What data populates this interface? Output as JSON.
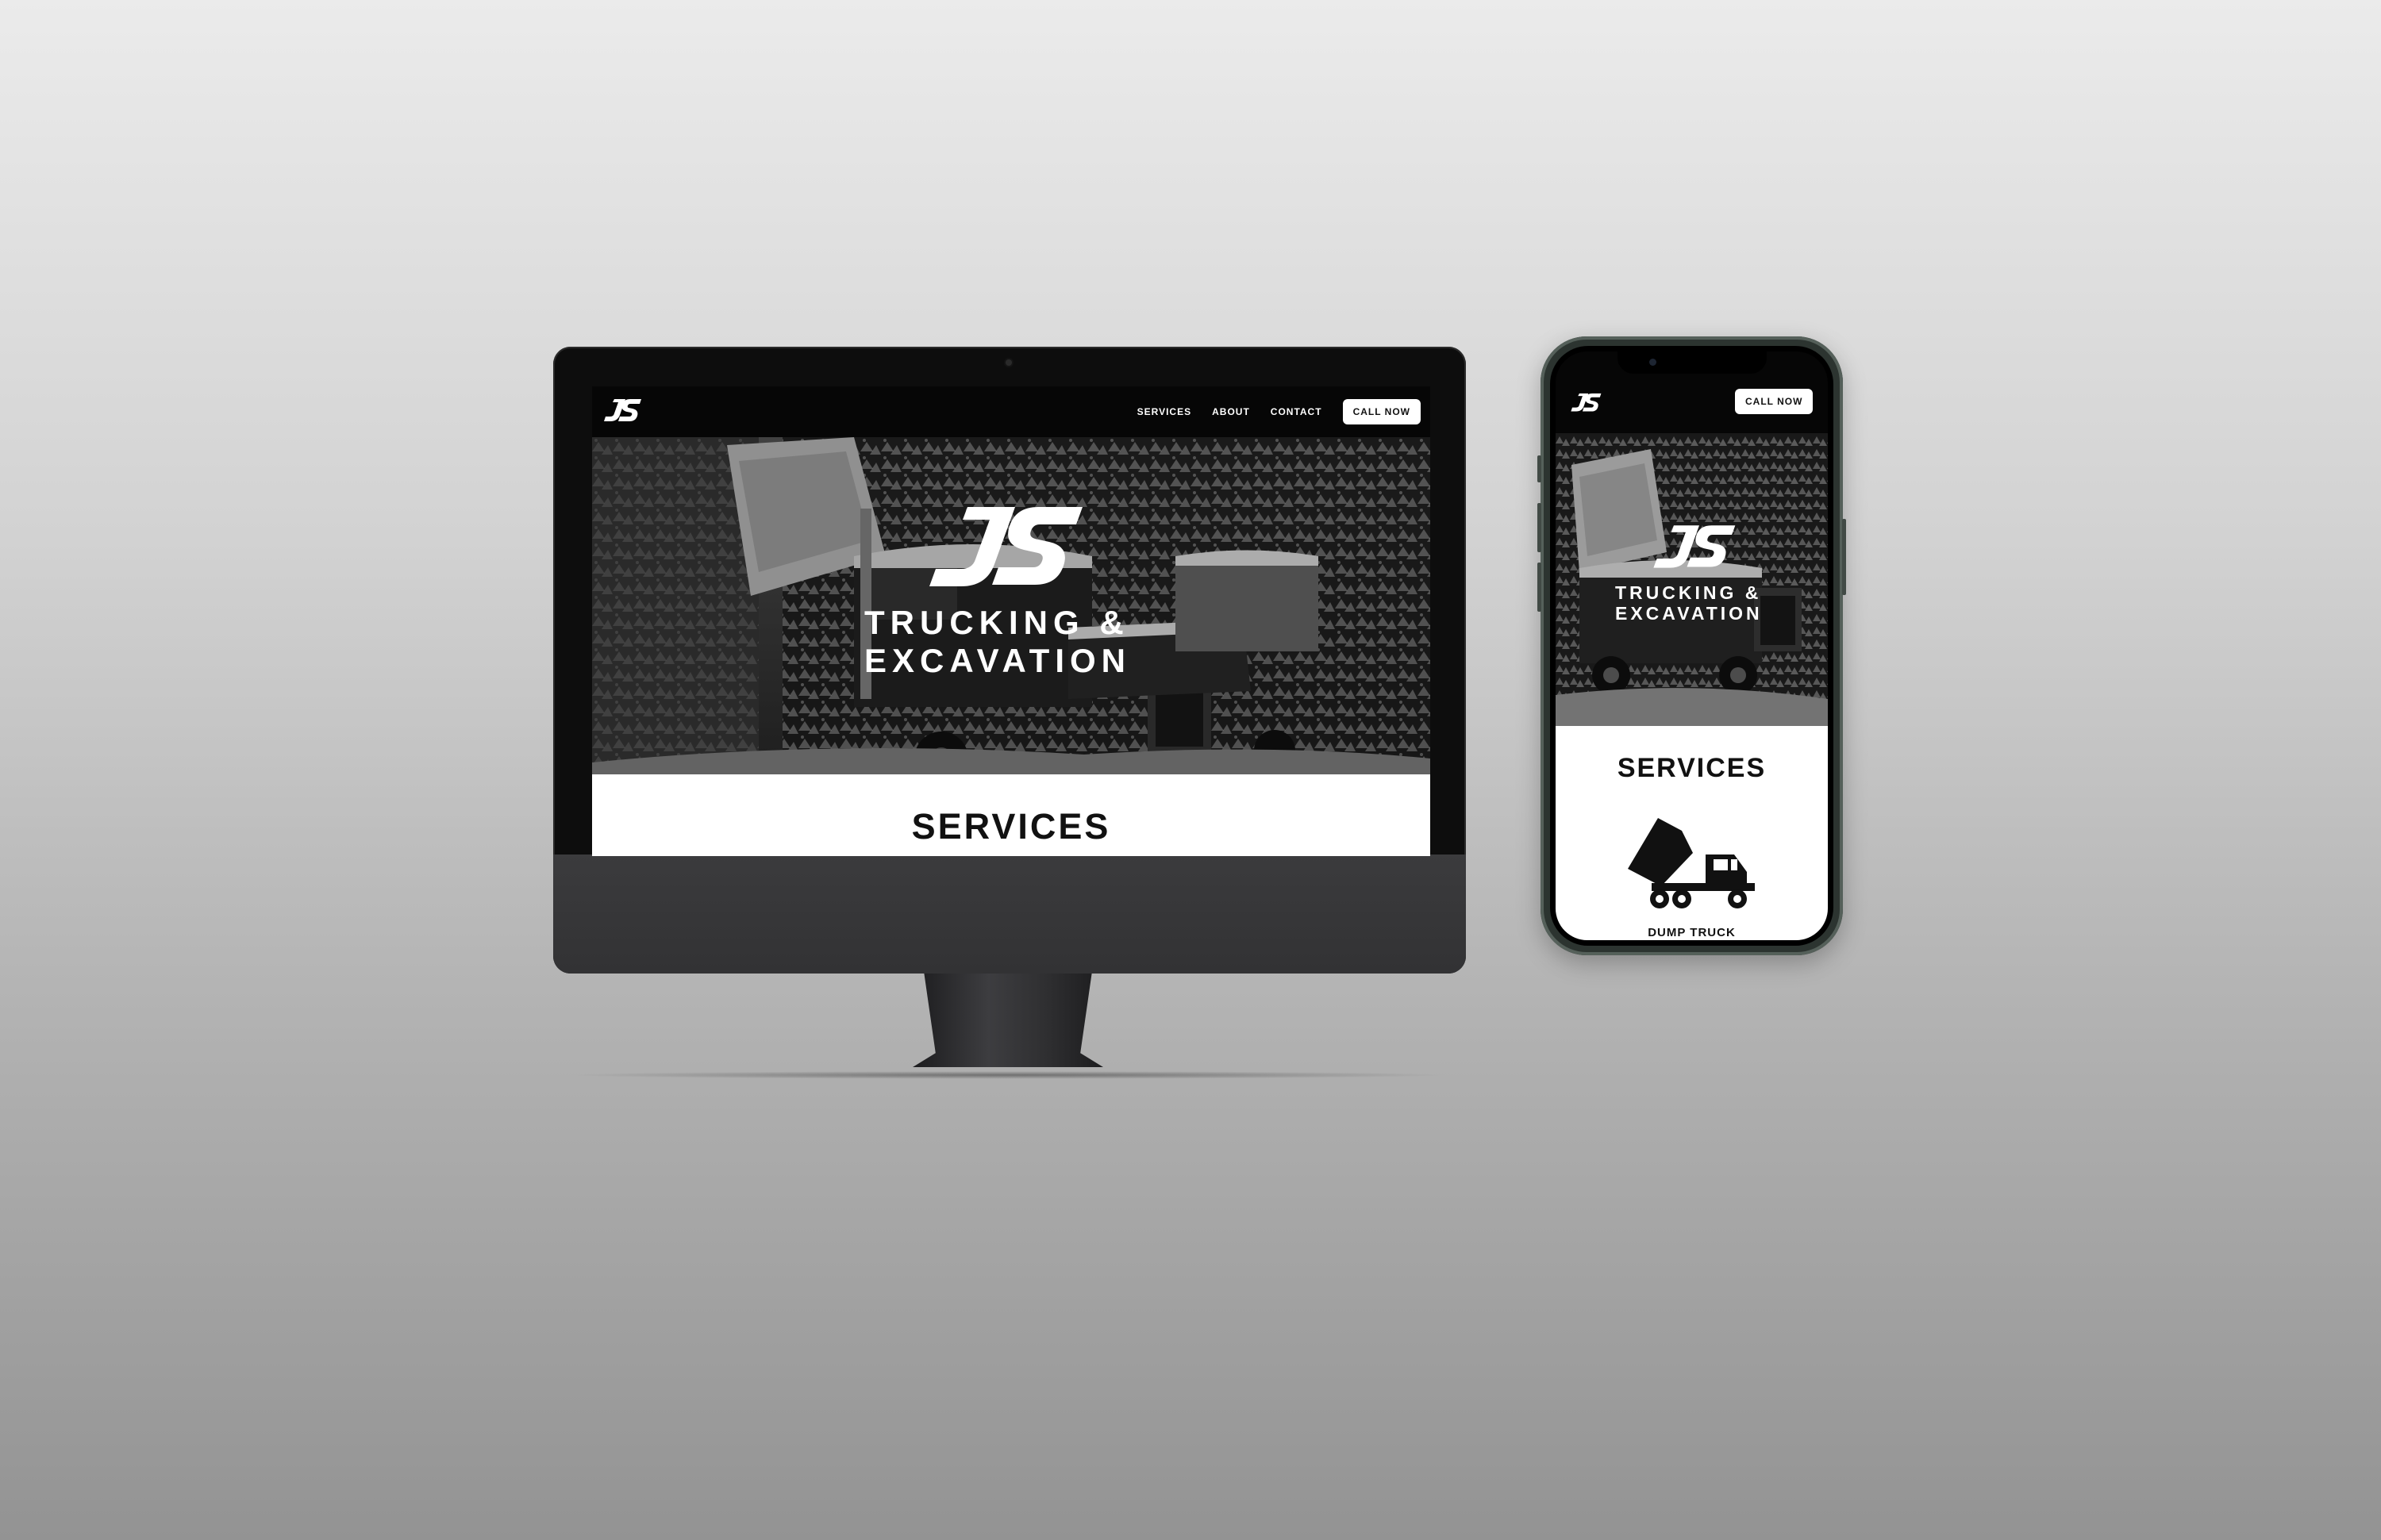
{
  "desktop": {
    "logo": "JS",
    "nav": {
      "links": [
        "SERVICES",
        "ABOUT",
        "CONTACT"
      ],
      "call_button": "CALL NOW"
    },
    "hero": {
      "logo": "JS",
      "line1": "TRUCKING &",
      "line2": "EXCAVATION"
    },
    "services": {
      "title": "SERVICES"
    }
  },
  "mobile": {
    "logo": "JS",
    "call_button": "CALL NOW",
    "hero": {
      "logo": "JS",
      "line1": "TRUCKING &",
      "line2": "EXCAVATION"
    },
    "services": {
      "title": "SERVICES",
      "items": [
        {
          "label": "DUMP TRUCK",
          "icon": "dump-truck-icon"
        }
      ]
    }
  },
  "colors": {
    "nav_background": "#060606",
    "button_background": "#ffffff",
    "text_dark": "#111111",
    "text_light": "#ffffff"
  }
}
